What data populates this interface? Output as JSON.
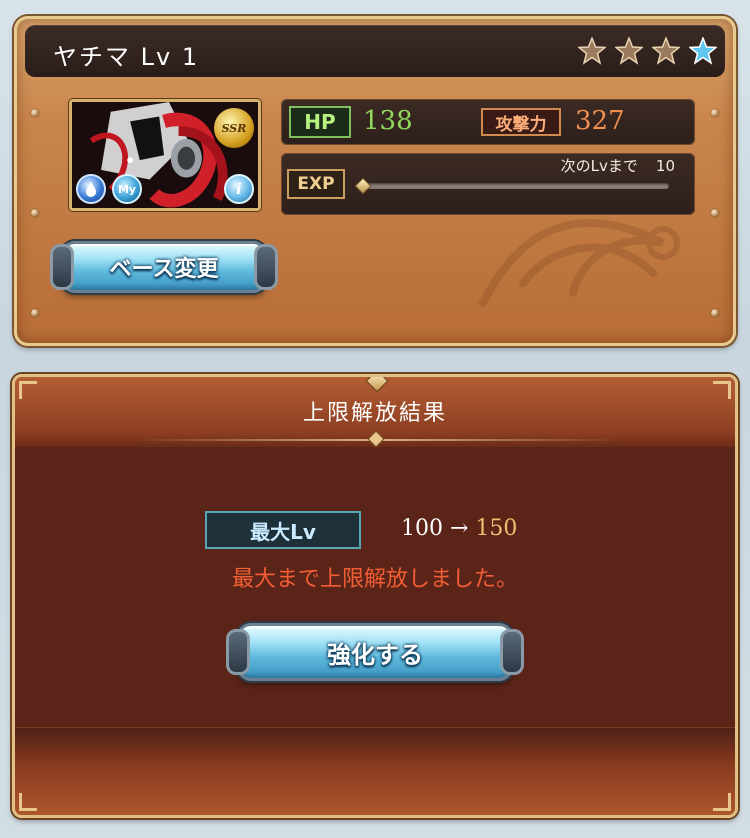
{
  "character": {
    "name": "ヤチマ Lv 1",
    "rarity": "SSR",
    "element_icon": "water-element-icon",
    "my_badge": "My",
    "info_icon": "i",
    "stars": [
      {
        "state": "locked",
        "label": "1"
      },
      {
        "state": "locked",
        "label": "2"
      },
      {
        "state": "locked",
        "label": "3"
      },
      {
        "state": "active",
        "label": "4"
      }
    ]
  },
  "stats": {
    "hp_label": "HP",
    "hp_value": "138",
    "atk_label": "攻撃力",
    "atk_value": "327",
    "exp_label": "EXP",
    "next_lv_label": "次のLvまで",
    "next_lv_value": "10",
    "exp_progress": 0.0
  },
  "buttons": {
    "base_change": "ベース変更",
    "enhance": "強化する"
  },
  "result": {
    "title": "上限解放結果",
    "max_lv_label": "最大Lv",
    "old_max": "100",
    "arrow": "→",
    "new_max": "150",
    "message": "最大まで上限解放しました。"
  },
  "colors": {
    "hp": "#8fd85a",
    "atk": "#f09050",
    "new_max": "#f0c070",
    "message": "#f25e34"
  }
}
